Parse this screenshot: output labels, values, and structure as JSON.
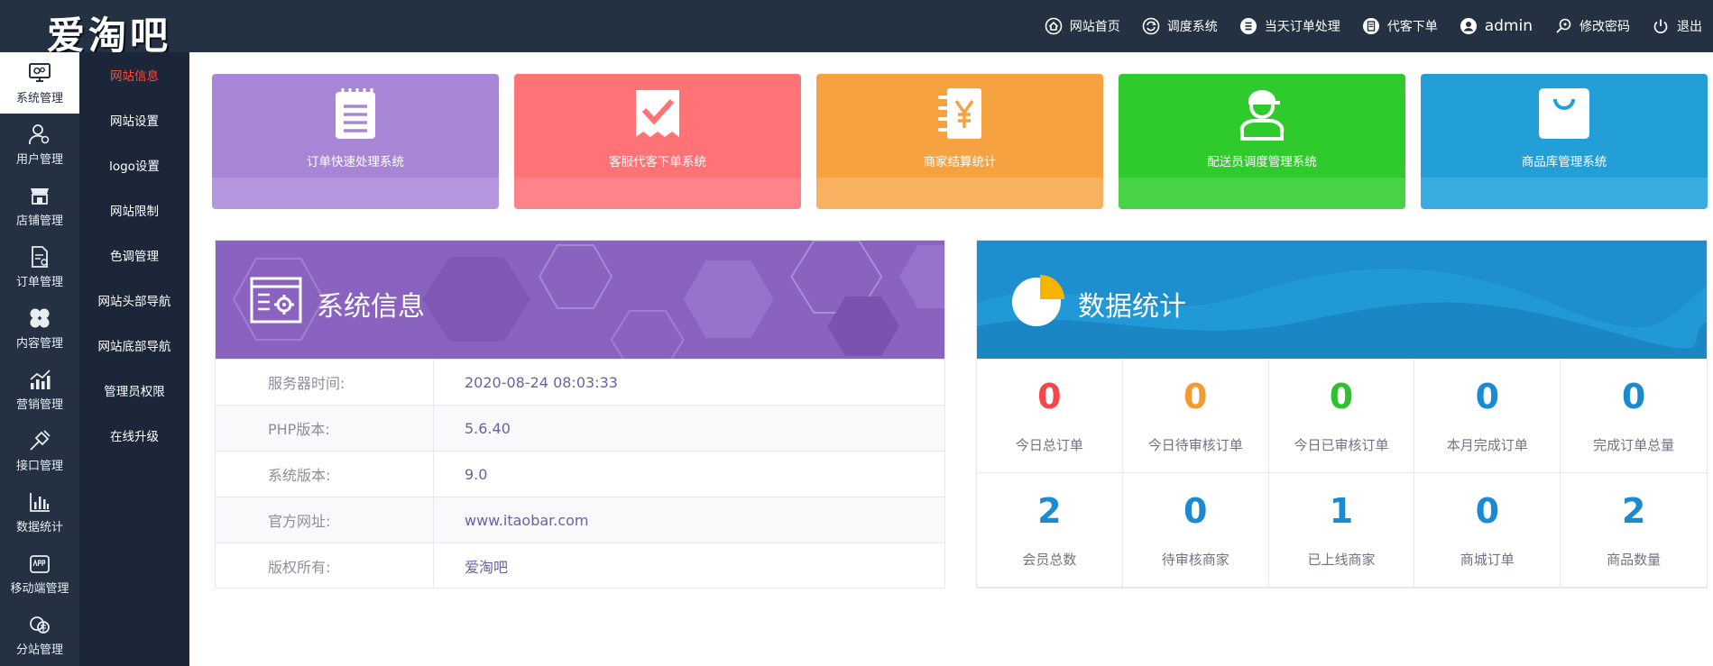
{
  "app": {
    "logo": "爱淘吧"
  },
  "topnav": [
    {
      "label": "网站首页",
      "icon": "home-icon"
    },
    {
      "label": "调度系统",
      "icon": "refresh-icon"
    },
    {
      "label": "当天订单处理",
      "icon": "list-icon"
    },
    {
      "label": "代客下单",
      "icon": "document-icon"
    },
    {
      "label": "admin",
      "icon": "user-icon"
    },
    {
      "label": "修改密码",
      "icon": "key-icon"
    },
    {
      "label": "退出",
      "icon": "power-icon"
    }
  ],
  "sidebar": [
    {
      "label": "系统管理",
      "icon": "monitor-gear-icon",
      "active": true
    },
    {
      "label": "用户管理",
      "icon": "user-gear-icon"
    },
    {
      "label": "店铺管理",
      "icon": "store-icon"
    },
    {
      "label": "订单管理",
      "icon": "order-doc-icon"
    },
    {
      "label": "内容管理",
      "icon": "clover-icon"
    },
    {
      "label": "营销管理",
      "icon": "trend-chart-icon"
    },
    {
      "label": "接口管理",
      "icon": "plug-icon"
    },
    {
      "label": "数据统计",
      "icon": "bar-chart-icon"
    },
    {
      "label": "移动端管理",
      "icon": "app-icon"
    },
    {
      "label": "分站管理",
      "icon": "coins-icon"
    }
  ],
  "subnav": [
    {
      "label": "网站信息",
      "active": true
    },
    {
      "label": "网站设置"
    },
    {
      "label": "logo设置"
    },
    {
      "label": "网站限制"
    },
    {
      "label": "色调管理"
    },
    {
      "label": "网站头部导航"
    },
    {
      "label": "网站底部导航"
    },
    {
      "label": "管理员权限"
    },
    {
      "label": "在线升级"
    }
  ],
  "cards": [
    {
      "title": "订单快速处理系统",
      "icon": "notepad-icon",
      "color": "#a886d6",
      "lower_color": "#b597df"
    },
    {
      "title": "客服代客下单系统",
      "icon": "receipt-check-icon",
      "color": "#ff7276",
      "lower_color": "#ff8388"
    },
    {
      "title": "商家结算统计",
      "icon": "yen-book-icon",
      "color": "#f6a240",
      "lower_color": "#f8b25f"
    },
    {
      "title": "配送员调度管理系统",
      "icon": "courier-icon",
      "color": "#2fcb2d",
      "lower_color": "#48d346"
    },
    {
      "title": "商品库管理系统",
      "icon": "shopping-bag-icon",
      "color": "#239fd8",
      "lower_color": "#3aacdf"
    }
  ],
  "system_info": {
    "title": "系统信息",
    "rows": [
      {
        "key": "服务器时间:",
        "value": "2020-08-24 08:03:33"
      },
      {
        "key": "PHP版本:",
        "value": "5.6.40"
      },
      {
        "key": "系统版本:",
        "value": "9.0"
      },
      {
        "key": "官方网址:",
        "value": "www.itaobar.com"
      },
      {
        "key": "版权所有:",
        "value": "爱淘吧"
      }
    ]
  },
  "stats": {
    "title": "数据统计",
    "items": [
      {
        "value": "0",
        "label": "今日总订单",
        "color": "#f5474b"
      },
      {
        "value": "0",
        "label": "今日待审核订单",
        "color": "#f39a33"
      },
      {
        "value": "0",
        "label": "今日已审核订单",
        "color": "#2fc030"
      },
      {
        "value": "0",
        "label": "本月完成订单",
        "color": "#1a8bd1"
      },
      {
        "value": "0",
        "label": "完成订单总量",
        "color": "#1a8bd1"
      },
      {
        "value": "2",
        "label": "会员总数",
        "color": "#1a8bd1"
      },
      {
        "value": "0",
        "label": "待审核商家",
        "color": "#1a8bd1"
      },
      {
        "value": "1",
        "label": "已上线商家",
        "color": "#1a8bd1"
      },
      {
        "value": "0",
        "label": "商城订单",
        "color": "#1a8bd1"
      },
      {
        "value": "2",
        "label": "商品数量",
        "color": "#1a8bd1"
      }
    ]
  }
}
